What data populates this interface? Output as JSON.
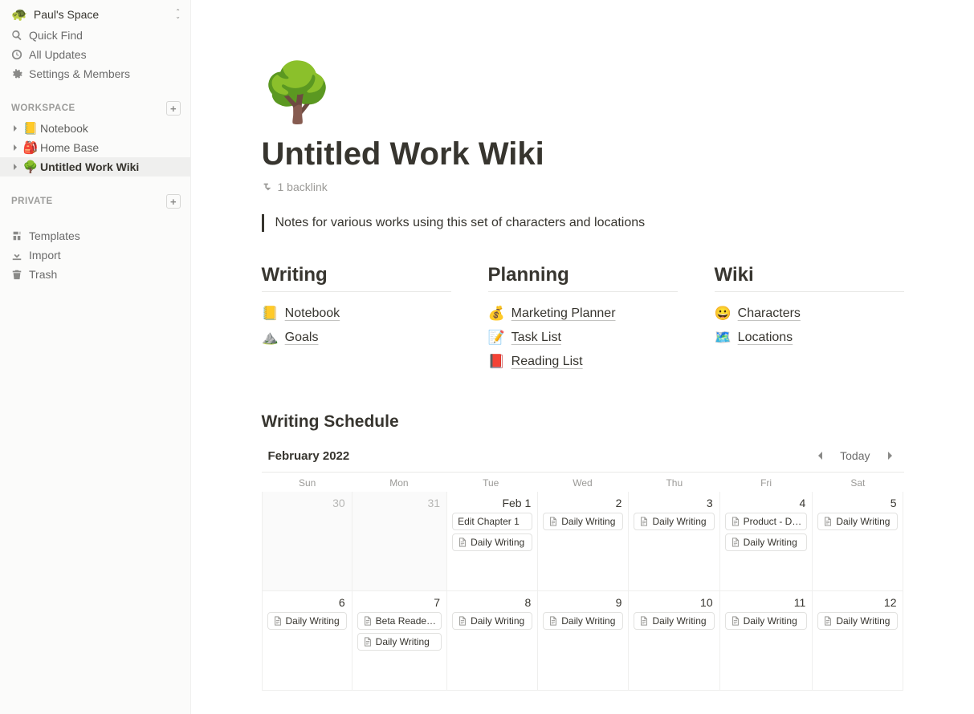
{
  "sidebar": {
    "workspace_emoji": "🐢",
    "workspace_name": "Paul's Space",
    "nav": {
      "quick_find": "Quick Find",
      "all_updates": "All Updates",
      "settings_members": "Settings & Members"
    },
    "section_workspace": "WORKSPACE",
    "section_private": "PRIVATE",
    "pages": [
      {
        "emoji": "📒",
        "label": "Notebook"
      },
      {
        "emoji": "🎒",
        "label": "Home Base"
      },
      {
        "emoji": "🌳",
        "label": "Untitled Work Wiki"
      }
    ],
    "bottom": {
      "templates": "Templates",
      "import": "Import",
      "trash": "Trash"
    }
  },
  "page": {
    "emoji": "🌳",
    "title": "Untitled Work Wiki",
    "backlink_text": "1 backlink",
    "callout": "Notes for various works using this set of characters and locations"
  },
  "columns": {
    "writing": {
      "title": "Writing",
      "items": [
        {
          "emoji": "📒",
          "label": "Notebook"
        },
        {
          "emoji": "⛰️",
          "label": "Goals"
        }
      ]
    },
    "planning": {
      "title": "Planning",
      "items": [
        {
          "emoji": "💰",
          "label": "Marketing Planner"
        },
        {
          "emoji": "📝",
          "label": "Task List"
        },
        {
          "emoji": "📕",
          "label": "Reading List"
        }
      ]
    },
    "wiki": {
      "title": "Wiki",
      "items": [
        {
          "emoji": "😀",
          "label": "Characters"
        },
        {
          "emoji": "🗺️",
          "label": "Locations"
        }
      ]
    }
  },
  "schedule": {
    "title": "Writing Schedule",
    "month_label": "February 2022",
    "today_label": "Today",
    "dow": [
      "Sun",
      "Mon",
      "Tue",
      "Wed",
      "Thu",
      "Fri",
      "Sat"
    ],
    "cells": [
      {
        "date": "30",
        "out": true,
        "events": []
      },
      {
        "date": "31",
        "out": true,
        "events": []
      },
      {
        "date": "Feb 1",
        "events": [
          {
            "label": "Edit Chapter 1",
            "icon": false
          },
          {
            "label": "Daily Writing",
            "icon": true
          }
        ]
      },
      {
        "date": "2",
        "events": [
          {
            "label": "Daily Writing",
            "icon": true
          }
        ]
      },
      {
        "date": "3",
        "events": [
          {
            "label": "Daily Writing",
            "icon": true
          }
        ]
      },
      {
        "date": "4",
        "events": [
          {
            "label": "Product - D…",
            "icon": true
          },
          {
            "label": "Daily Writing",
            "icon": true
          }
        ]
      },
      {
        "date": "5",
        "events": [
          {
            "label": "Daily Writing",
            "icon": true
          }
        ]
      },
      {
        "date": "6",
        "events": [
          {
            "label": "Daily Writing",
            "icon": true
          }
        ]
      },
      {
        "date": "7",
        "events": [
          {
            "label": "Beta Reade…",
            "icon": true
          },
          {
            "label": "Daily Writing",
            "icon": true
          }
        ]
      },
      {
        "date": "8",
        "events": [
          {
            "label": "Daily Writing",
            "icon": true
          }
        ]
      },
      {
        "date": "9",
        "events": [
          {
            "label": "Daily Writing",
            "icon": true
          }
        ]
      },
      {
        "date": "10",
        "events": [
          {
            "label": "Daily Writing",
            "icon": true
          }
        ]
      },
      {
        "date": "11",
        "events": [
          {
            "label": "Daily Writing",
            "icon": true
          }
        ]
      },
      {
        "date": "12",
        "events": [
          {
            "label": "Daily Writing",
            "icon": true
          }
        ]
      }
    ]
  }
}
